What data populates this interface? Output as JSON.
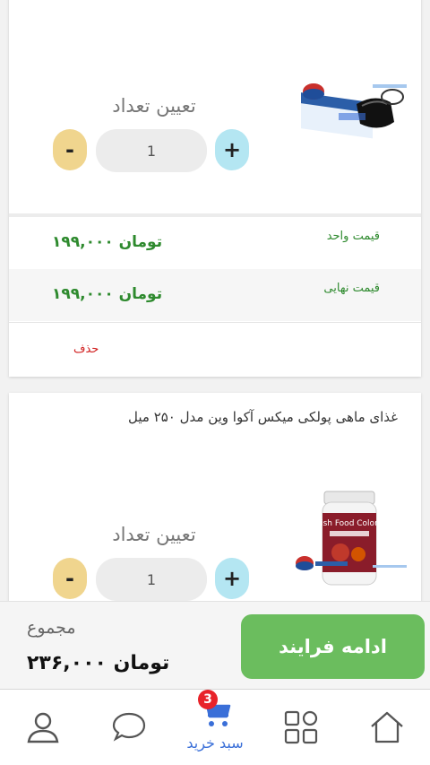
{
  "cart": {
    "items": [
      {
        "quantity_label": "تعیین تعداد",
        "quantity": "1",
        "minus": "-",
        "plus": "+",
        "unit_price_label": "قیمت واحد",
        "unit_price": "۱۹۹,۰۰۰ تومان",
        "final_price_label": "قیمت نهایی",
        "final_price": "۱۹۹,۰۰۰ تومان",
        "delete_label": "حذف"
      },
      {
        "title": "غذای ماهی پولکی میکس آکوا وین مدل ۲۵۰ میل",
        "quantity_label": "تعیین تعداد",
        "quantity": "1",
        "minus": "-",
        "plus": "+",
        "image_text": "Fish Food Colors"
      }
    ]
  },
  "summary": {
    "total_label": "مجموع",
    "total_value": "۲۳۶,۰۰۰ تومان",
    "continue_label": "ادامه فرایند"
  },
  "nav": {
    "items": [
      {
        "icon": "profile-icon"
      },
      {
        "icon": "chat-icon"
      },
      {
        "icon": "cart-icon",
        "label": "سبد خرید",
        "badge": "3"
      },
      {
        "icon": "categories-icon"
      },
      {
        "icon": "home-icon"
      }
    ]
  },
  "colors": {
    "accent_green": "#6bbd5e",
    "price_green": "#2e8a2e",
    "delete_red": "#d12020",
    "nav_active": "#3a6fd8",
    "minus_bg": "#f0d58e",
    "plus_bg": "#b4e6f2"
  }
}
